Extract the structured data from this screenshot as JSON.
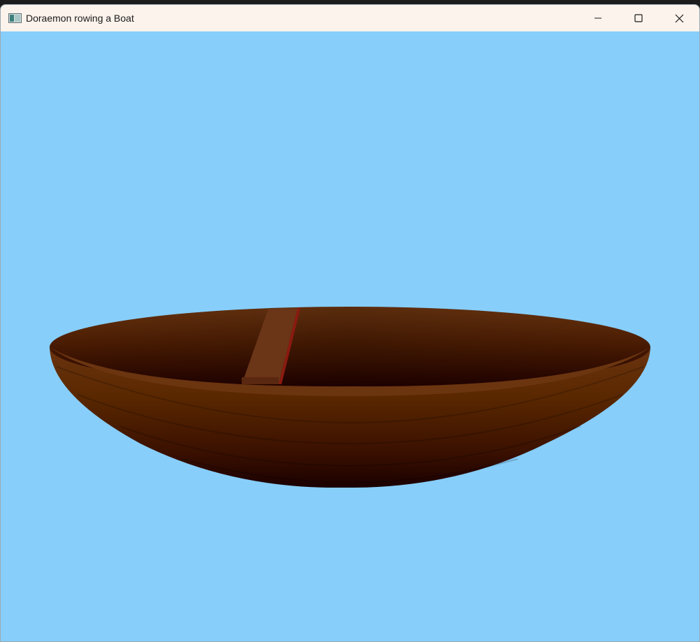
{
  "window": {
    "title": "Doraemon rowing a Boat",
    "icon": "opengl-window-icon",
    "controls": {
      "minimize_icon": "minimize-icon",
      "maximize_icon": "maximize-icon",
      "close_icon": "close-icon"
    }
  },
  "scene": {
    "background_color": "#87cefa",
    "boat": {
      "rim_color": "#6b3510",
      "hull_top_color": "#6a3410",
      "hull_bottom_color": "#200000",
      "inner_color": "#2a0400"
    },
    "plank": {
      "top_color": "#6b3518",
      "edge_color": "#8b1a10"
    }
  }
}
